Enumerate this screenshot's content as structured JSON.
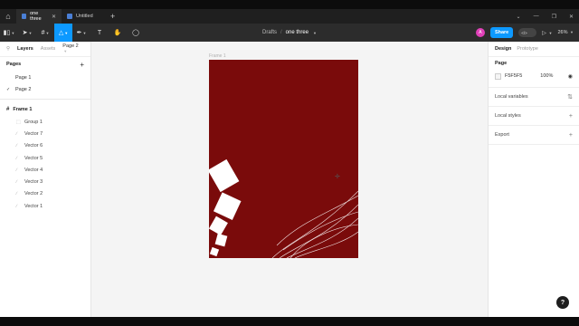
{
  "titlebar": {
    "tabs": [
      {
        "label": "one three",
        "active": true
      },
      {
        "label": "Untitled",
        "active": false
      }
    ]
  },
  "toolbar": {
    "breadcrumb_parent": "Drafts",
    "breadcrumb_separator": "/",
    "file_name": "one three",
    "avatar_initial": "A",
    "share_label": "Share",
    "dev_mode_label": "</>",
    "zoom": "26%"
  },
  "left_panel": {
    "tabs": [
      "Layers",
      "Assets"
    ],
    "page_selector": "Page 2",
    "pages_heading": "Pages",
    "pages": [
      {
        "label": "Page 1",
        "selected": false
      },
      {
        "label": "Page 2",
        "selected": true
      }
    ],
    "frame_layer": "Frame 1",
    "layers": [
      "Group 1",
      "Vector 7",
      "Vector 6",
      "Vector 5",
      "Vector 4",
      "Vector 3",
      "Vector 2",
      "Vector 1"
    ]
  },
  "canvas": {
    "frame_label": "Frame 1",
    "frame_color": "#7a0b0b"
  },
  "right_panel": {
    "tabs": [
      "Design",
      "Prototype"
    ],
    "page_heading": "Page",
    "page_color_hex": "F5F5F5",
    "page_color_opacity": "100%",
    "local_variables": "Local variables",
    "local_styles": "Local styles",
    "export": "Export"
  },
  "help_label": "?",
  "colors": {
    "accent": "#0d99ff",
    "frame": "#7a0b0b",
    "avatar": "#e040b8"
  }
}
